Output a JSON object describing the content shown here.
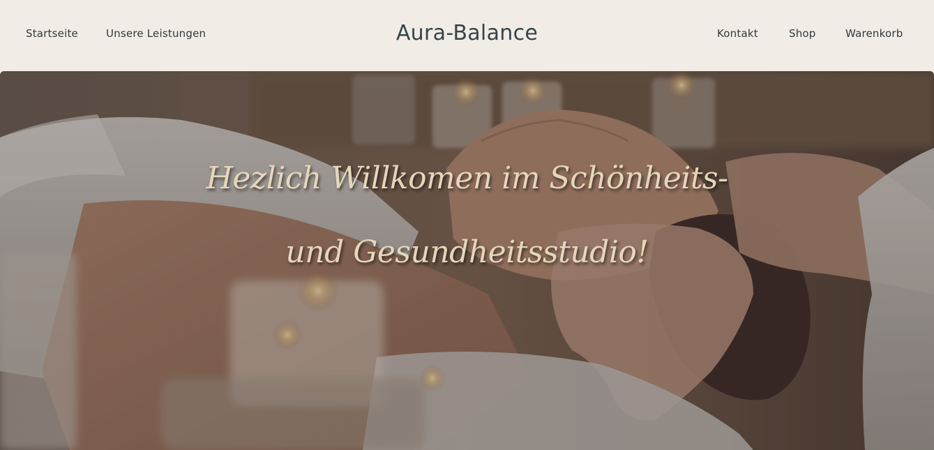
{
  "header": {
    "logo": "Aura-Balance",
    "nav_left": [
      "Startseite",
      "Unsere Leistungen"
    ],
    "nav_right": [
      "Kontakt",
      "Shop",
      "Warenkorb"
    ]
  },
  "hero": {
    "title_line1": "Hezlich Willkomen im Schönheits-",
    "title_line2": "und Gesundheitsstudio!",
    "image": "spa-massage-photo"
  },
  "colors": {
    "background": "#f2ece6",
    "text": "#2f3a3c",
    "hero_title": "#e6d6bb"
  }
}
